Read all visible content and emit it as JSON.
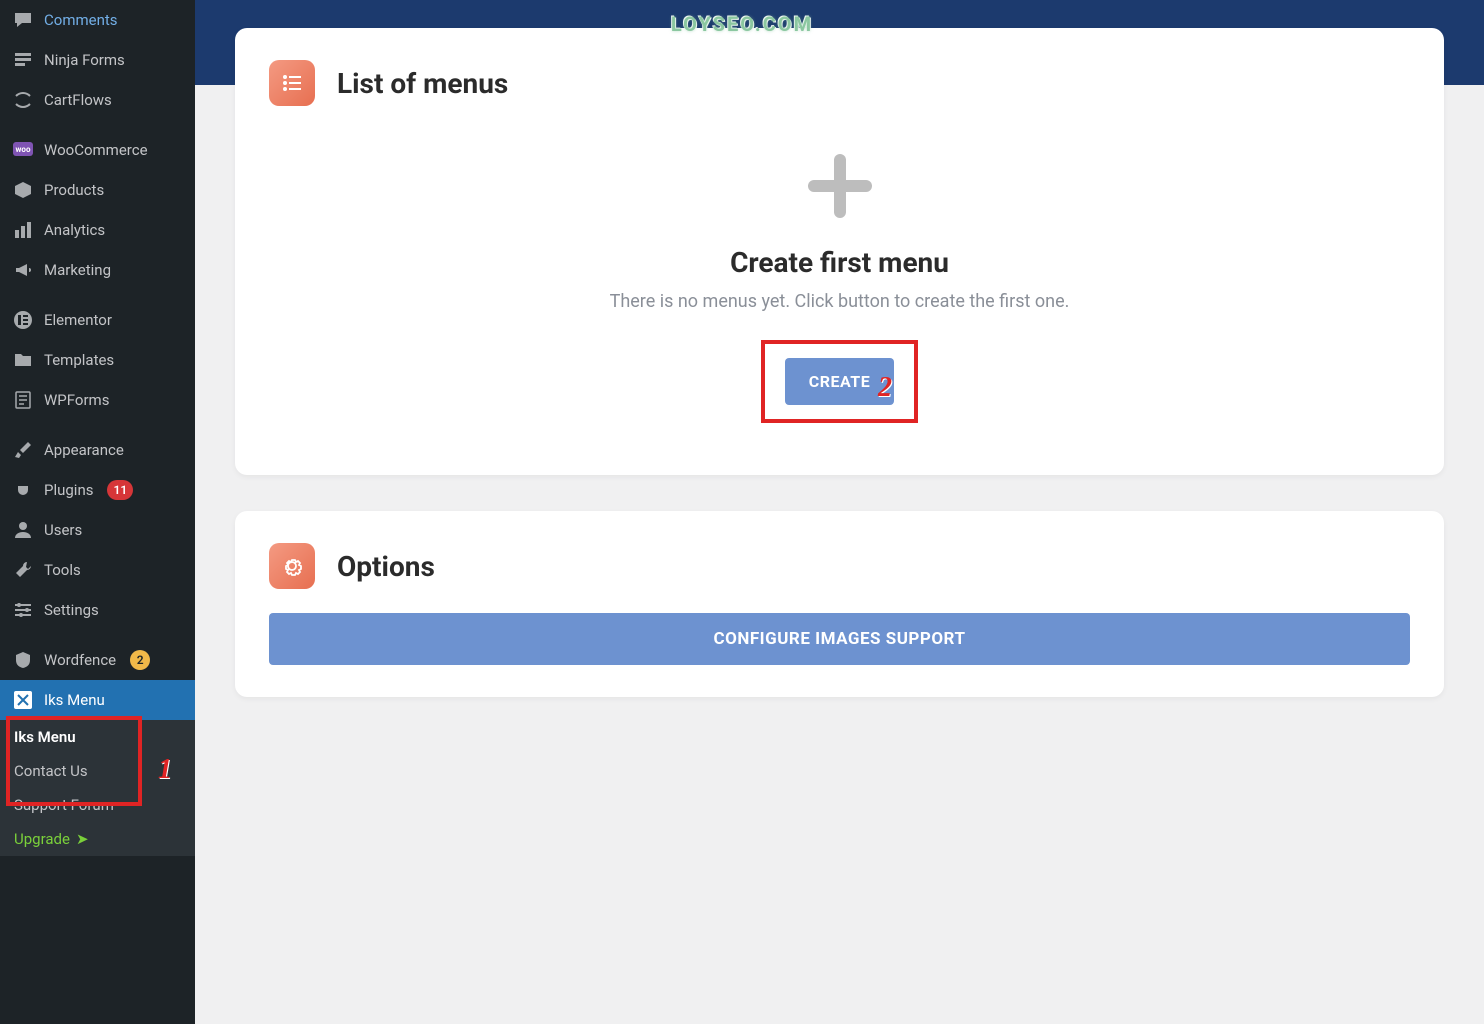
{
  "watermark": "LOYSEO.COM",
  "sidebar": {
    "items": [
      {
        "label": "Comments",
        "icon": "comment-icon"
      },
      {
        "label": "Ninja Forms",
        "icon": "form-icon"
      },
      {
        "label": "CartFlows",
        "icon": "cartflows-icon"
      },
      {
        "label": "WooCommerce",
        "icon": "woo-icon"
      },
      {
        "label": "Products",
        "icon": "box-icon"
      },
      {
        "label": "Analytics",
        "icon": "chart-icon"
      },
      {
        "label": "Marketing",
        "icon": "megaphone-icon"
      },
      {
        "label": "Elementor",
        "icon": "elementor-icon"
      },
      {
        "label": "Templates",
        "icon": "folder-icon"
      },
      {
        "label": "WPForms",
        "icon": "wpforms-icon"
      },
      {
        "label": "Appearance",
        "icon": "brush-icon"
      },
      {
        "label": "Plugins",
        "icon": "plug-icon",
        "badge": "11",
        "badge_color": "orange"
      },
      {
        "label": "Users",
        "icon": "user-icon"
      },
      {
        "label": "Tools",
        "icon": "wrench-icon"
      },
      {
        "label": "Settings",
        "icon": "settings-icon"
      },
      {
        "label": "Wordfence",
        "icon": "wordfence-icon",
        "badge": "2",
        "badge_color": "yellow"
      },
      {
        "label": "Iks Menu",
        "icon": "iks-icon",
        "active": true
      }
    ],
    "submenu": [
      {
        "label": "Iks Menu",
        "current": true
      },
      {
        "label": "Contact Us"
      },
      {
        "label": "Support Forum"
      },
      {
        "label": "Upgrade",
        "upgrade": true
      }
    ]
  },
  "cards": {
    "menus": {
      "title": "List of menus",
      "empty_title": "Create first menu",
      "empty_sub": "There is no menus yet. Click button to create the first one.",
      "create_label": "CREATE"
    },
    "options": {
      "title": "Options",
      "configure_label": "CONFIGURE IMAGES SUPPORT"
    }
  },
  "annotations": {
    "one": "1",
    "two": "2"
  }
}
